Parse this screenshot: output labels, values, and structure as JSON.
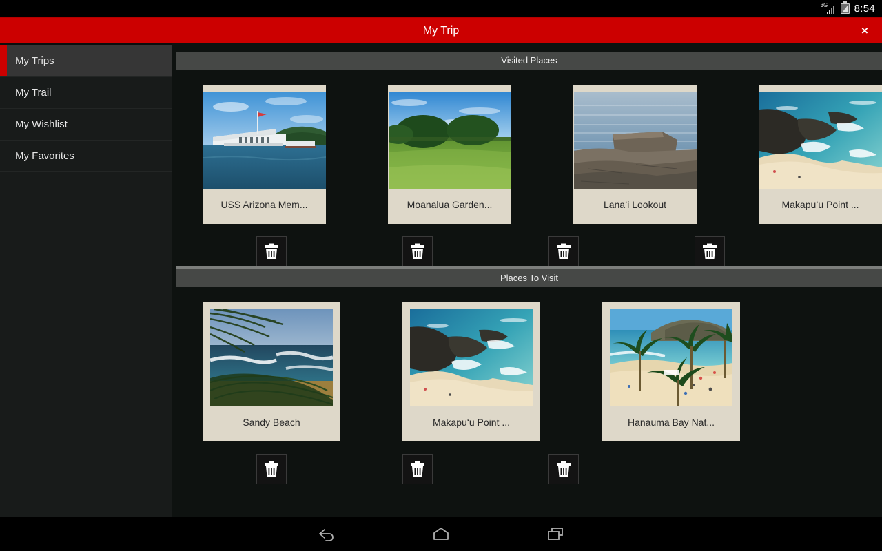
{
  "status_bar": {
    "network_label": "3G",
    "signal_icon": "signal-bars-icon",
    "battery_icon": "battery-icon",
    "time": "8:54"
  },
  "title_bar": {
    "title": "My Trip",
    "close_label": "×",
    "background_color": "#cc0000"
  },
  "sidebar": {
    "items": [
      {
        "label": "My Trips",
        "selected": true
      },
      {
        "label": "My Trail",
        "selected": false
      },
      {
        "label": "My Wishlist",
        "selected": false
      },
      {
        "label": "My Favorites",
        "selected": false
      }
    ],
    "accent_color": "#cc0000"
  },
  "sections": [
    {
      "heading": "Visited Places",
      "cards": [
        {
          "label": "USS Arizona Mem...",
          "delete_label": "delete"
        },
        {
          "label": "Moanalua Garden...",
          "delete_label": "delete"
        },
        {
          "label": "Lanaʻi Lookout",
          "delete_label": "delete"
        },
        {
          "label": "Makapuʻu Point ...",
          "delete_label": "delete"
        }
      ]
    },
    {
      "heading": "Places To Visit",
      "cards": [
        {
          "label": "Sandy Beach",
          "delete_label": "delete"
        },
        {
          "label": "Makapuʻu Point ...",
          "delete_label": "delete"
        },
        {
          "label": "Hanauma Bay Nat...",
          "delete_label": "delete"
        }
      ]
    }
  ],
  "nav_bar": {
    "back_icon": "back-arrow-icon",
    "home_icon": "home-icon",
    "recents_icon": "recent-apps-icon"
  },
  "colors": {
    "card_background": "#ded8c9",
    "section_header": "#464846",
    "content_background": "#0e1210",
    "sidebar_background": "#181b1a"
  }
}
